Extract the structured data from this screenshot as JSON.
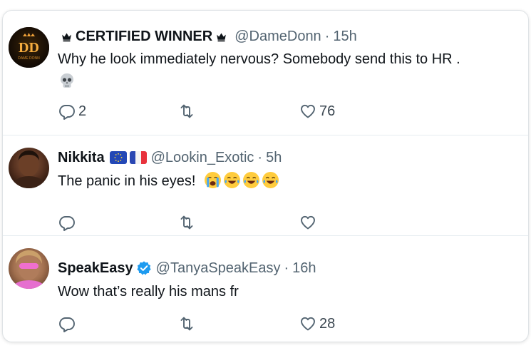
{
  "tweets": [
    {
      "name": "CERTIFIED WINNER",
      "handle": "@DameDonn",
      "separator": "·",
      "time": "15h",
      "text": "Why he look immediately nervous? Somebody send this to HR .",
      "avatar_logo_text": "DAME DONN",
      "emojis": [
        "skull-emoji"
      ],
      "replies": "2",
      "likes": "76"
    },
    {
      "name": "Nikkita",
      "handle": "@Lookin_Exotic",
      "separator": "·",
      "time": "5h",
      "text": "The panic in his eyes!",
      "flags": [
        "eu-flag",
        "france-flag"
      ],
      "emojis": [
        "loudly-crying-emoji",
        "tears-of-joy-emoji",
        "tears-of-joy-emoji",
        "tears-of-joy-emoji"
      ],
      "replies": "",
      "likes": ""
    },
    {
      "name": "SpeakEasy",
      "handle": "@TanyaSpeakEasy",
      "separator": "·",
      "time": "16h",
      "text": "Wow that’s really his mans fr",
      "verified": true,
      "replies": "",
      "likes": "28"
    }
  ],
  "icons": {
    "reply": "reply-icon",
    "retweet": "retweet-icon",
    "like": "like-icon",
    "verified": "verified-badge-icon",
    "crown": "crown-icon"
  },
  "colors": {
    "text": "#0f1419",
    "muted": "#536471",
    "verified": "#1d9bf0",
    "divider": "#e6ecf0"
  }
}
